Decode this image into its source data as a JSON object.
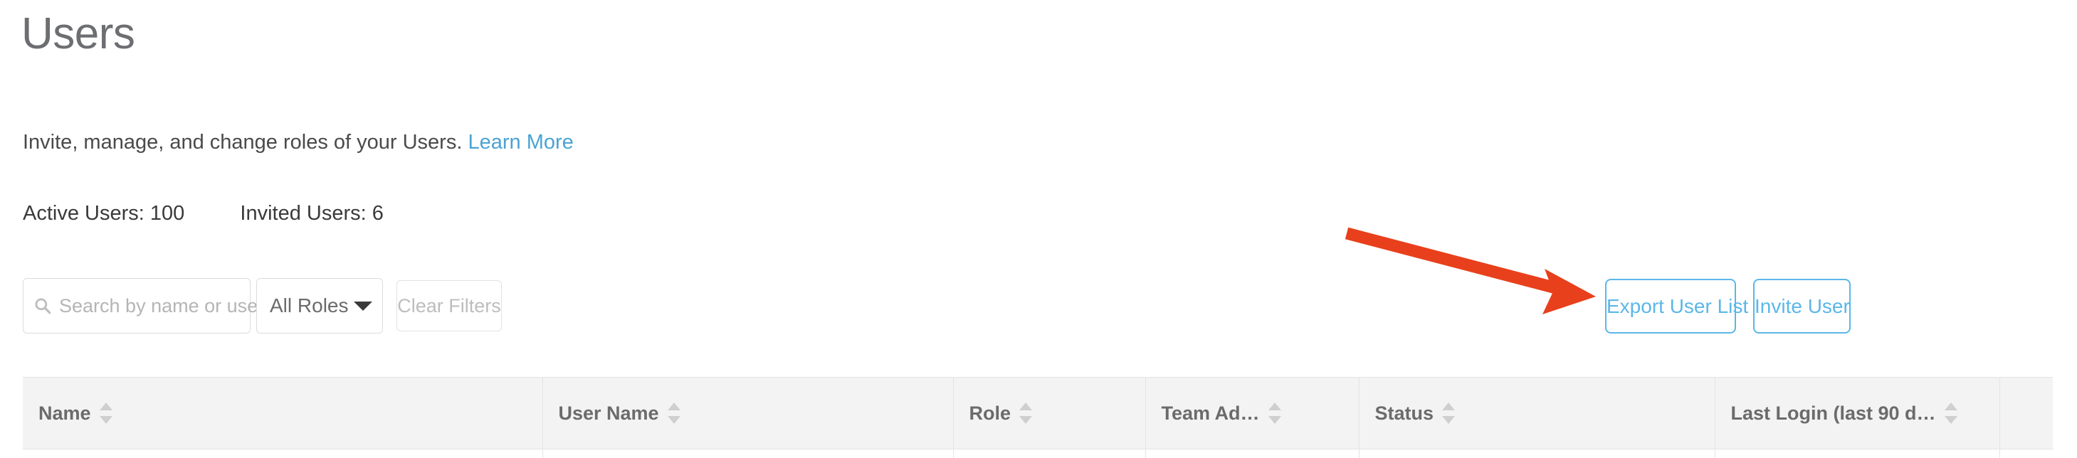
{
  "header": {
    "title": "Users",
    "subtitle_text": "Invite, manage, and change roles of your Users.",
    "learn_more_label": "Learn More"
  },
  "stats": {
    "active_users": "Active Users: 100",
    "invited_users": "Invited Users: 6"
  },
  "filters": {
    "search_placeholder": "Search by name or username",
    "search_value": "",
    "search_icon": "search-icon",
    "roles_selected": "All Roles",
    "roles_caret_icon": "chevron-down-icon",
    "clear_filters_label": "Clear Filters"
  },
  "actions": {
    "export_label": "Export User List CSV",
    "invite_label": "Invite User"
  },
  "table": {
    "columns": [
      {
        "label": "Name",
        "sortable": true
      },
      {
        "label": "User Name",
        "sortable": true
      },
      {
        "label": "Role",
        "sortable": true
      },
      {
        "label": "Team Ad…",
        "sortable": true
      },
      {
        "label": "Status",
        "sortable": true
      },
      {
        "label": "Last Login (last 90 d…",
        "sortable": true
      },
      {
        "label": "",
        "sortable": false
      }
    ],
    "sort_icon": "sort-arrows-icon",
    "rows": []
  },
  "annotation": {
    "arrow_icon": "arrow-pointer-icon",
    "arrow_color": "#e8401c",
    "points_to": "Export User List CSV"
  },
  "colors": {
    "accent_blue": "#5bb7e8",
    "link_blue": "#4aa3d2",
    "title_gray": "#6d6e71",
    "header_bg": "#f3f3f3",
    "border_gray": "#e4e4e4",
    "annotation_red": "#e8401c"
  }
}
